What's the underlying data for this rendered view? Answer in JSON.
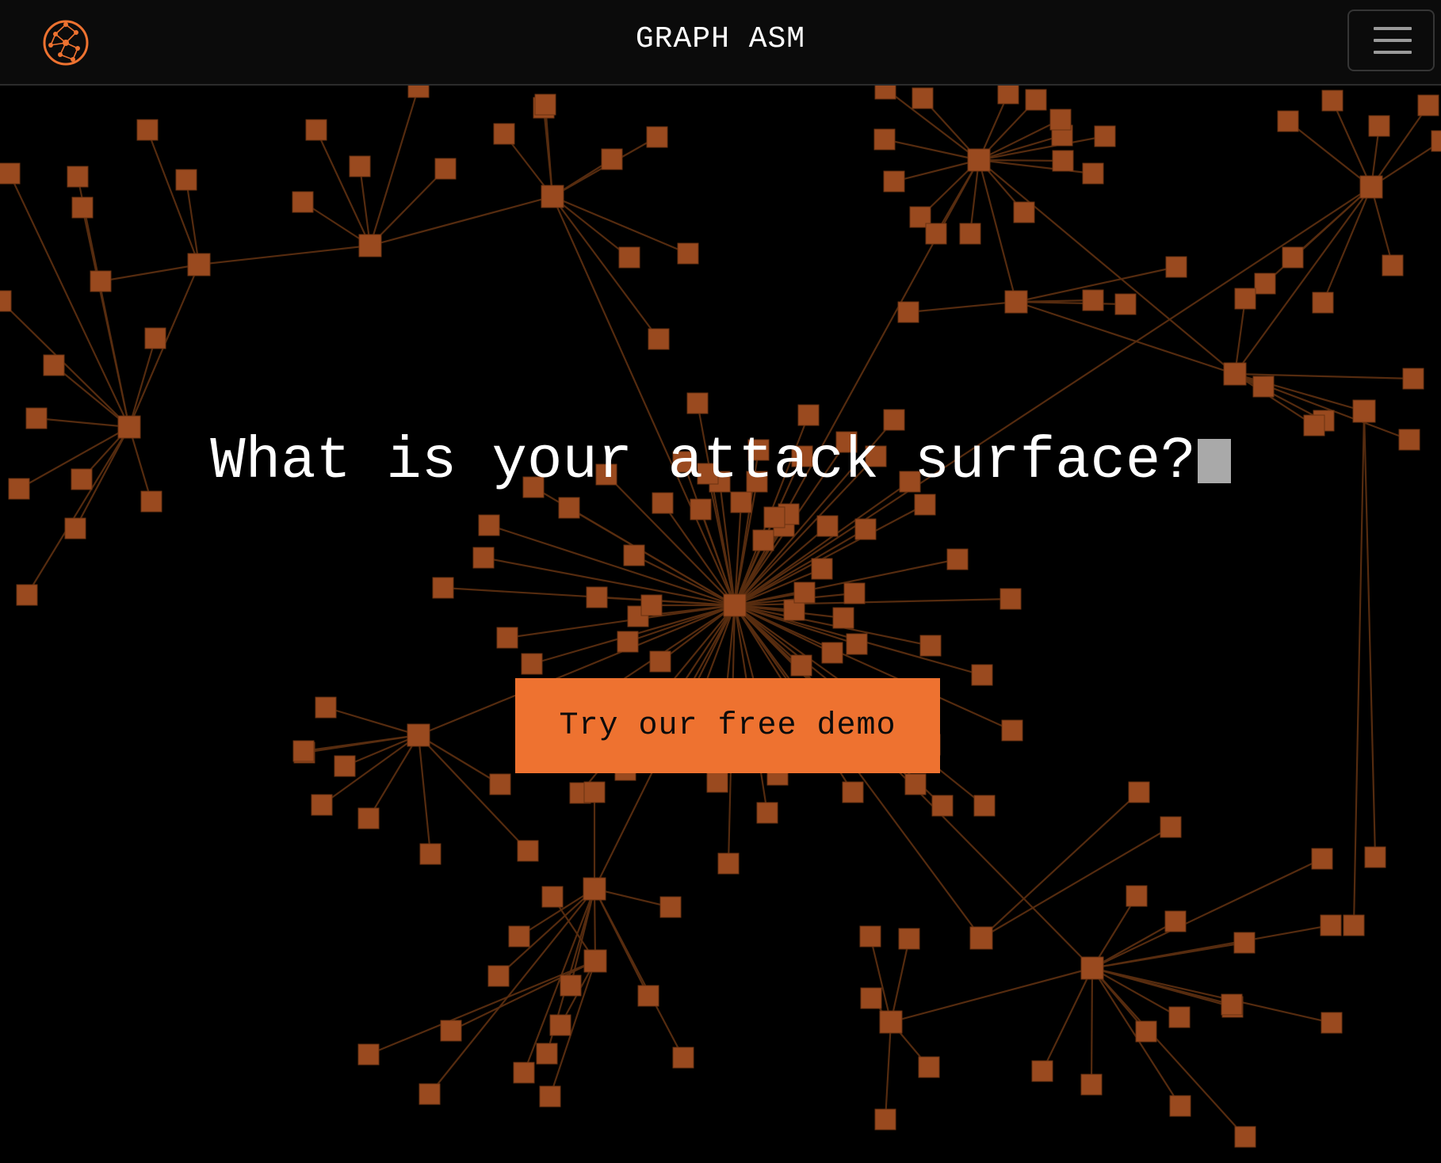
{
  "header": {
    "brand": "GRAPH ASM",
    "logo_icon": "network-globe-icon",
    "menu_icon": "hamburger-menu-icon"
  },
  "hero": {
    "headline": "What is your attack surface?",
    "cta_label": "Try our free demo"
  },
  "colors": {
    "accent": "#ee7230",
    "node": "#9a4a1f",
    "edge": "#5a2d10",
    "background": "#000000",
    "topbar": "#0b0b0b"
  },
  "background_graphic": "network-graph"
}
